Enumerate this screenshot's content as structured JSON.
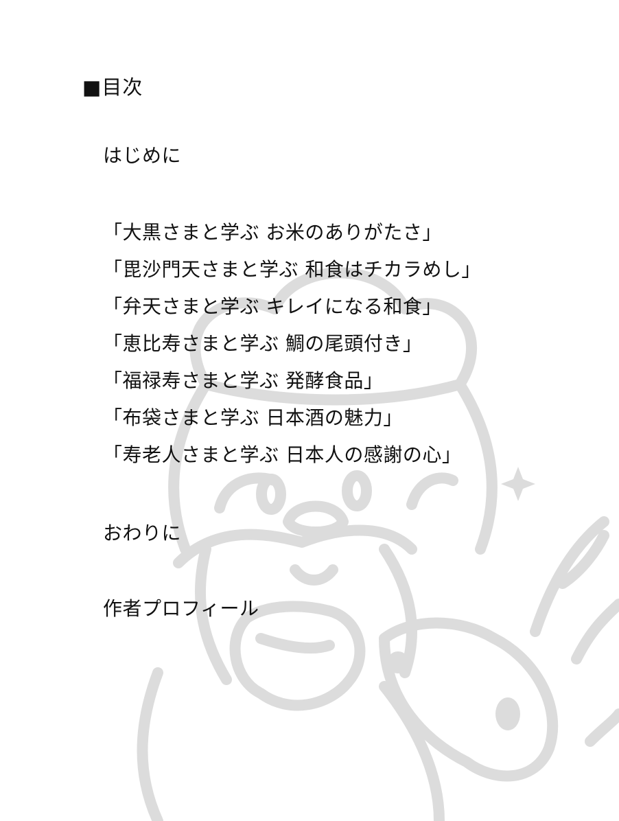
{
  "heading": "■目次",
  "intro": "はじめに",
  "chapters": [
    "「大黒さまと学ぶ お米のありがたさ」",
    "「毘沙門天さまと学ぶ 和食はチカラめし」",
    "「弁天さまと学ぶ キレイになる和食」",
    "「恵比寿さまと学ぶ 鯛の尾頭付き」",
    "「福禄寿さまと学ぶ 発酵食品」",
    "「布袋さまと学ぶ 日本酒の魅力」",
    "「寿老人さまと学ぶ 日本人の感謝の心」"
  ],
  "outro": "おわりに",
  "profile": "作者プロフィール",
  "colors": {
    "text": "#111111",
    "illustration": "#dcdcdc"
  }
}
